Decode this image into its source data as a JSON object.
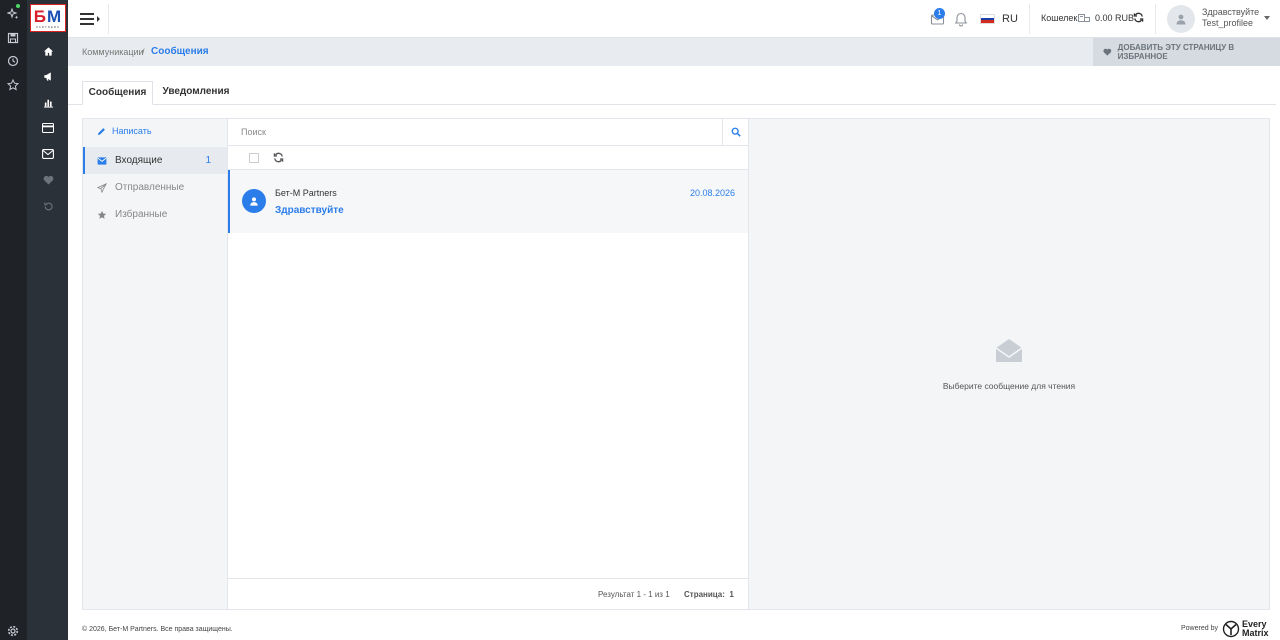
{
  "logo": {
    "text_b": "Б",
    "text_m": "M",
    "subtitle": "PARTNERS"
  },
  "header": {
    "mail_badge": "1",
    "language": "RU",
    "wallet_label": "Кошелек",
    "wallet_amount": "0.00 RUB",
    "greeting": "Здравствуйте",
    "username": "Test_profilee"
  },
  "breadcrumb": {
    "parent": "Коммуникации",
    "separator": "/",
    "current": "Сообщения",
    "favorite_button": "ДОБАВИТЬ ЭТУ СТРАНИЦУ В ИЗБРАННОЕ"
  },
  "tabs": [
    {
      "label": "Сообщения",
      "active": true
    },
    {
      "label": "Уведомления",
      "active": false
    }
  ],
  "folders": {
    "compose": "Написать",
    "items": [
      {
        "label": "Входящие",
        "count": "1",
        "active": true
      },
      {
        "label": "Отправленные",
        "count": "",
        "active": false
      },
      {
        "label": "Избранные",
        "count": "",
        "active": false
      }
    ]
  },
  "list": {
    "search_placeholder": "Поиск",
    "messages": [
      {
        "sender": "Бет-М Partners",
        "date": "20.08.2026",
        "subject": "Здравствуйте"
      }
    ],
    "result_text": "Результат 1 - 1 из 1",
    "page_label": "Страница:",
    "page_number": "1"
  },
  "reader": {
    "hint": "Выберите сообщение для чтения"
  },
  "footer": {
    "copyright": "© 2026, Бет-М Partners. Все права защищены.",
    "powered_by": "Powered by",
    "brand_line1": "Every",
    "brand_line2": "Matrix"
  },
  "colors": {
    "accent": "#2b7de9",
    "sidebar_dark": "#1f2328",
    "nav_bg": "#2b3138",
    "panel_bg": "#f3f5f7"
  }
}
